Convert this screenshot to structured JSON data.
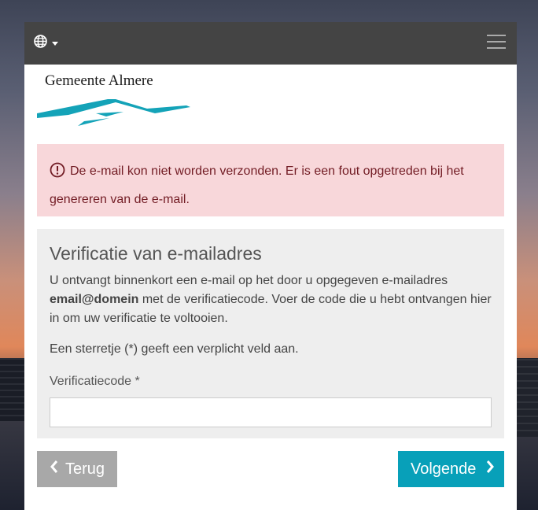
{
  "header": {
    "language_icon": "globe-icon",
    "menu_icon": "hamburger-menu-icon"
  },
  "logo": {
    "text": "Gemeente Almere",
    "colors": {
      "wave": "#14a3b8"
    }
  },
  "alert": {
    "icon": "exclamation-circle-icon",
    "message": "De e-mail kon niet worden verzonden. Er is een fout opgetreden bij het genereren van de e-mail."
  },
  "panel": {
    "title": "Verificatie van e-mailadres",
    "intro_pre": "U ontvangt binnenkort een e-mail op het door u opgegeven e-mailadres ",
    "intro_email": "email@domein",
    "intro_post": " met de verificatiecode. Voer de code die u hebt ontvangen hier in om uw verificatie te voltooien.",
    "required_note": "Een sterretje (*) geeft een verplicht veld aan.",
    "field_label": "Verificatiecode *",
    "field_value": ""
  },
  "buttons": {
    "back_label": "Terug",
    "next_label": "Volgende"
  },
  "colors": {
    "topbar": "#444444",
    "alert_bg": "#f8d7da",
    "alert_text": "#721c24",
    "primary": "#08a0b9",
    "secondary": "#a8a8a8"
  }
}
